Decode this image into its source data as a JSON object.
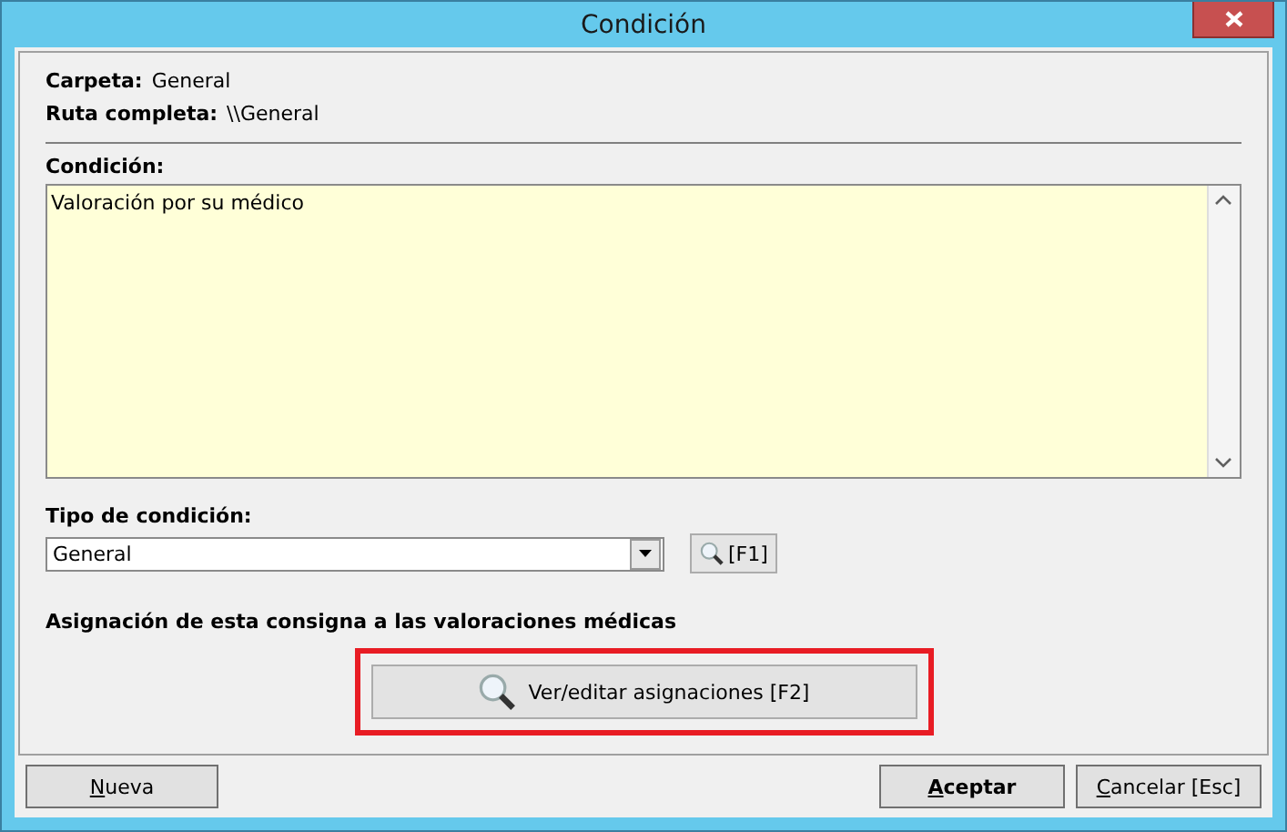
{
  "window": {
    "title": "Condición"
  },
  "info": [
    {
      "label": "Carpeta:",
      "value": "General"
    },
    {
      "label": "Ruta completa:",
      "value": "\\\\General"
    }
  ],
  "condition": {
    "label": "Condición:",
    "value": "Valoración por su médico"
  },
  "type": {
    "label": "Tipo de condición:",
    "value": "General",
    "lookup_button": "[F1]"
  },
  "assignment": {
    "label": "Asignación de esta consigna a las valoraciones médicas",
    "button": "Ver/editar asignaciones  [F2]",
    "highlighted": true
  },
  "footer": {
    "buttons": [
      {
        "label": "Nueva",
        "default": false
      },
      {
        "label": "Aceptar",
        "default": true
      },
      {
        "label": "Cancelar  [Esc]",
        "default": false
      }
    ]
  }
}
